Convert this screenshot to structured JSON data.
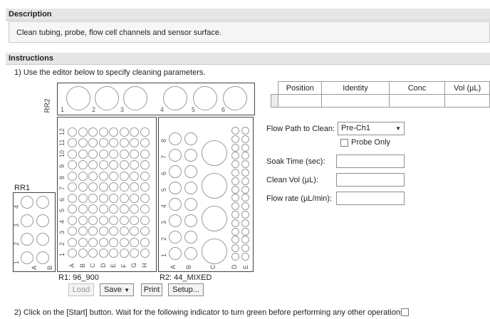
{
  "description": {
    "header": "Description",
    "text": "Clean tubing, probe, flow cell channels and sensor surface."
  },
  "instructions": {
    "header": "Instructions",
    "step1": "1) Use the editor below to specify cleaning parameters.",
    "step2": "2) Click on the [Start] button.  Wait for the following indicator to turn green before performing any other operations."
  },
  "racks": {
    "rr2_label": "RR2",
    "rr2_numbers": [
      "1",
      "2",
      "3",
      "4",
      "5",
      "6"
    ],
    "rr1_label": "RR1",
    "rr1_row_numbers": [
      "1",
      "2",
      "3",
      "4"
    ],
    "rr1_col_letters": [
      "A",
      "B"
    ],
    "r1_row_numbers": [
      "1",
      "2",
      "3",
      "4",
      "5",
      "6",
      "7",
      "8",
      "9",
      "10",
      "11",
      "12"
    ],
    "r1_col_letters": [
      "A",
      "B",
      "C",
      "D",
      "E",
      "F",
      "G",
      "H"
    ],
    "r1_caption": "R1:  96_900",
    "r2_side_numbers": [
      "1",
      "2",
      "3",
      "4",
      "5",
      "6",
      "7",
      "8"
    ],
    "r2_col_letters": [
      "A",
      "B",
      "C",
      "D",
      "E"
    ],
    "r2_caption": "R2:  44_MIXED"
  },
  "buttons": {
    "load": "Load",
    "save": "Save",
    "print": "Print",
    "setup": "Setup..."
  },
  "table": {
    "headers": [
      "Position",
      "Identity",
      "Conc",
      "Vol (µL)"
    ]
  },
  "form": {
    "flow_path_label": "Flow Path to Clean:",
    "flow_path_value": "Pre-Ch1",
    "probe_only_label": "Probe Only",
    "soak_time_label": "Soak Time (sec):",
    "soak_time_value": "",
    "clean_vol_label": "Clean Vol (µL):",
    "clean_vol_value": "",
    "flow_rate_label": "Flow rate (µL/min):",
    "flow_rate_value": ""
  }
}
